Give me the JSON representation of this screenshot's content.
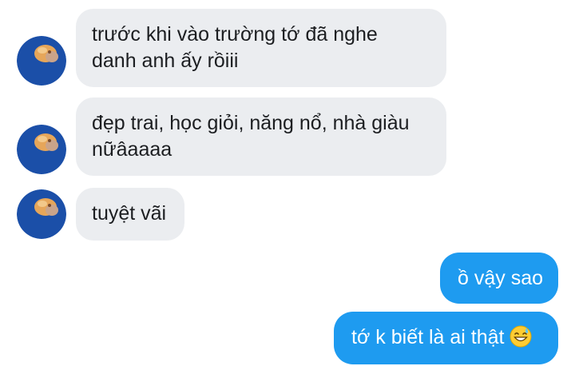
{
  "conversation": {
    "messages": [
      {
        "side": "incoming",
        "lines": [
          "trước khi vào trường tớ đã nghe",
          "danh anh ấy rồiii"
        ]
      },
      {
        "side": "incoming",
        "lines": [
          "đẹp trai, học giỏi, năng nổ, nhà giàu",
          "nữâaaaa"
        ]
      },
      {
        "side": "incoming",
        "lines": [
          "tuyệt vãi"
        ]
      },
      {
        "side": "outgoing",
        "lines": [
          "ồ vậy sao"
        ]
      },
      {
        "side": "outgoing",
        "lines": [
          "tớ k biết là ai thật"
        ],
        "emoji": "grinning-sweat-emoji"
      }
    ]
  },
  "colors": {
    "incoming_bubble": "#ebedf0",
    "outgoing_bubble": "#1e9bf0",
    "avatar_background": "#1b4fa8"
  }
}
